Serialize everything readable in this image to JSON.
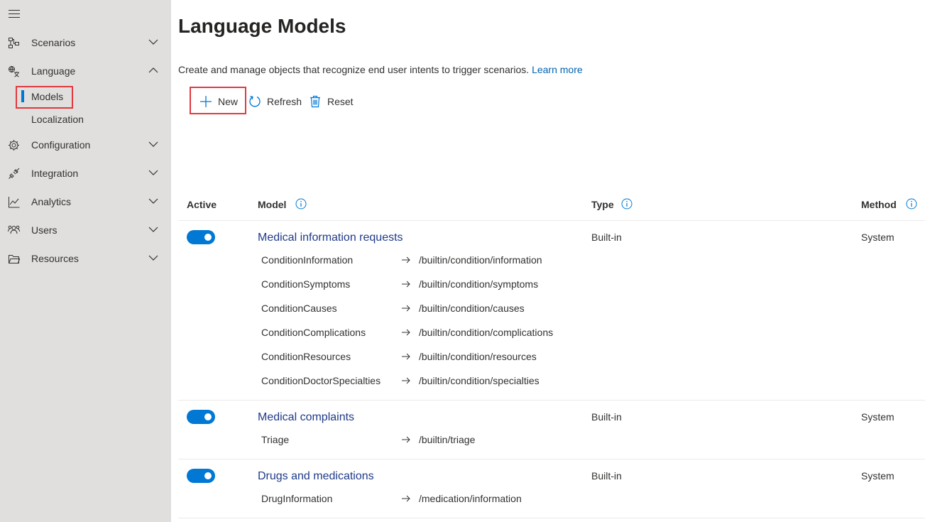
{
  "sidebar": {
    "items": [
      {
        "label": "Scenarios",
        "icon": "flow-icon",
        "expanded": false
      },
      {
        "label": "Language",
        "icon": "language-icon",
        "expanded": true
      },
      {
        "label": "Configuration",
        "icon": "gear-icon",
        "expanded": false
      },
      {
        "label": "Integration",
        "icon": "plug-icon",
        "expanded": false
      },
      {
        "label": "Analytics",
        "icon": "chart-icon",
        "expanded": false
      },
      {
        "label": "Users",
        "icon": "users-icon",
        "expanded": false
      },
      {
        "label": "Resources",
        "icon": "folder-icon",
        "expanded": false
      }
    ],
    "language_sub": [
      {
        "label": "Models",
        "active": true
      },
      {
        "label": "Localization",
        "active": false
      }
    ]
  },
  "main": {
    "title": "Language Models",
    "description": "Create and manage objects that recognize end user intents to trigger scenarios.",
    "learn_more": "Learn more",
    "commands": {
      "new": "New",
      "refresh": "Refresh",
      "reset": "Reset"
    },
    "columns": {
      "active": "Active",
      "model": "Model",
      "type": "Type",
      "method": "Method"
    },
    "models": [
      {
        "name": "Medical information requests",
        "type": "Built-in",
        "method": "System",
        "active": true,
        "intents": [
          {
            "name": "ConditionInformation",
            "route": "/builtin/condition/information"
          },
          {
            "name": "ConditionSymptoms",
            "route": "/builtin/condition/symptoms"
          },
          {
            "name": "ConditionCauses",
            "route": "/builtin/condition/causes"
          },
          {
            "name": "ConditionComplications",
            "route": "/builtin/condition/complications"
          },
          {
            "name": "ConditionResources",
            "route": "/builtin/condition/resources"
          },
          {
            "name": "ConditionDoctorSpecialties",
            "route": "/builtin/condition/specialties"
          }
        ]
      },
      {
        "name": "Medical complaints",
        "type": "Built-in",
        "method": "System",
        "active": true,
        "intents": [
          {
            "name": "Triage",
            "route": "/builtin/triage"
          }
        ]
      },
      {
        "name": "Drugs and medications",
        "type": "Built-in",
        "method": "System",
        "active": true,
        "intents": [
          {
            "name": "DrugInformation",
            "route": "/medication/information"
          }
        ]
      }
    ]
  },
  "colors": {
    "accent": "#0078d4",
    "link": "#0063b1",
    "highlight": "#e0393e",
    "sidebar_bg": "#e1dfdd"
  }
}
